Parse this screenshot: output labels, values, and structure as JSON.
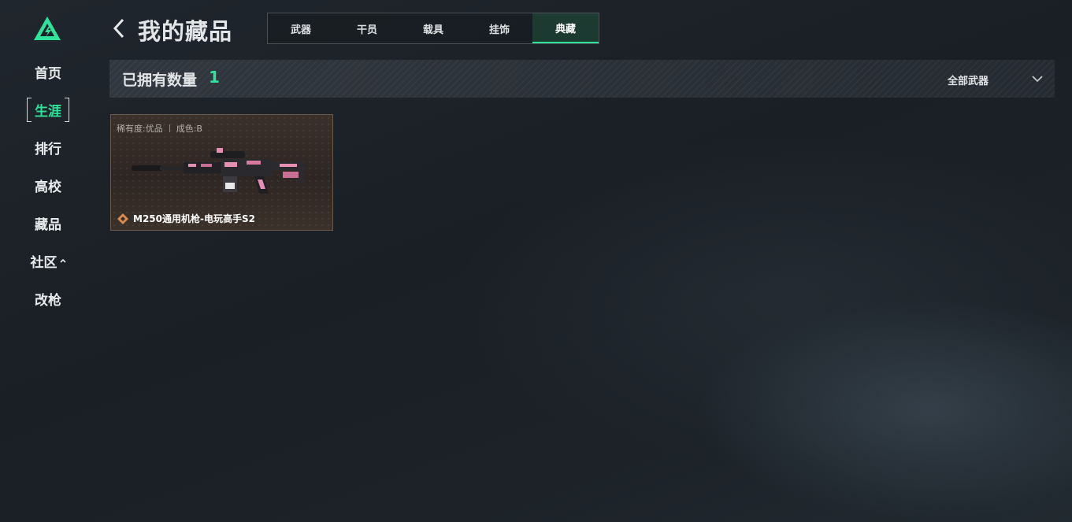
{
  "sidebar": {
    "logo": "triangle-logo",
    "items": [
      {
        "label": "首页",
        "active": false
      },
      {
        "label": "生涯",
        "active": true
      },
      {
        "label": "排行",
        "active": false
      },
      {
        "label": "高校",
        "active": false
      },
      {
        "label": "藏品",
        "active": false
      },
      {
        "label": "社区",
        "active": false,
        "icon": "chevron-up-icon"
      },
      {
        "label": "改枪",
        "active": false
      }
    ]
  },
  "header": {
    "back_icon": "chevron-left-icon",
    "title": "我的藏品",
    "tabs": [
      {
        "label": "武器",
        "active": false
      },
      {
        "label": "干员",
        "active": false
      },
      {
        "label": "载具",
        "active": false
      },
      {
        "label": "挂饰",
        "active": false
      },
      {
        "label": "典藏",
        "active": true
      }
    ]
  },
  "summary": {
    "count_label": "已拥有数量",
    "count_value": "1",
    "filter": {
      "selected": "全部武器",
      "icon": "chevron-down-icon"
    }
  },
  "items": [
    {
      "rarity": "稀有度:优品",
      "wear": "成色:B",
      "name": "M250通用机枪-电玩高手S2",
      "rarity_icon": "diamond-rarity-icon",
      "image": "machine-gun-image"
    }
  ],
  "colors": {
    "accent": "#2fe39a",
    "background": "#1d2329",
    "card_border": "#6a5a4d",
    "rarity_orange": "#d98a4e",
    "weapon_pink": "#e58fb2"
  }
}
